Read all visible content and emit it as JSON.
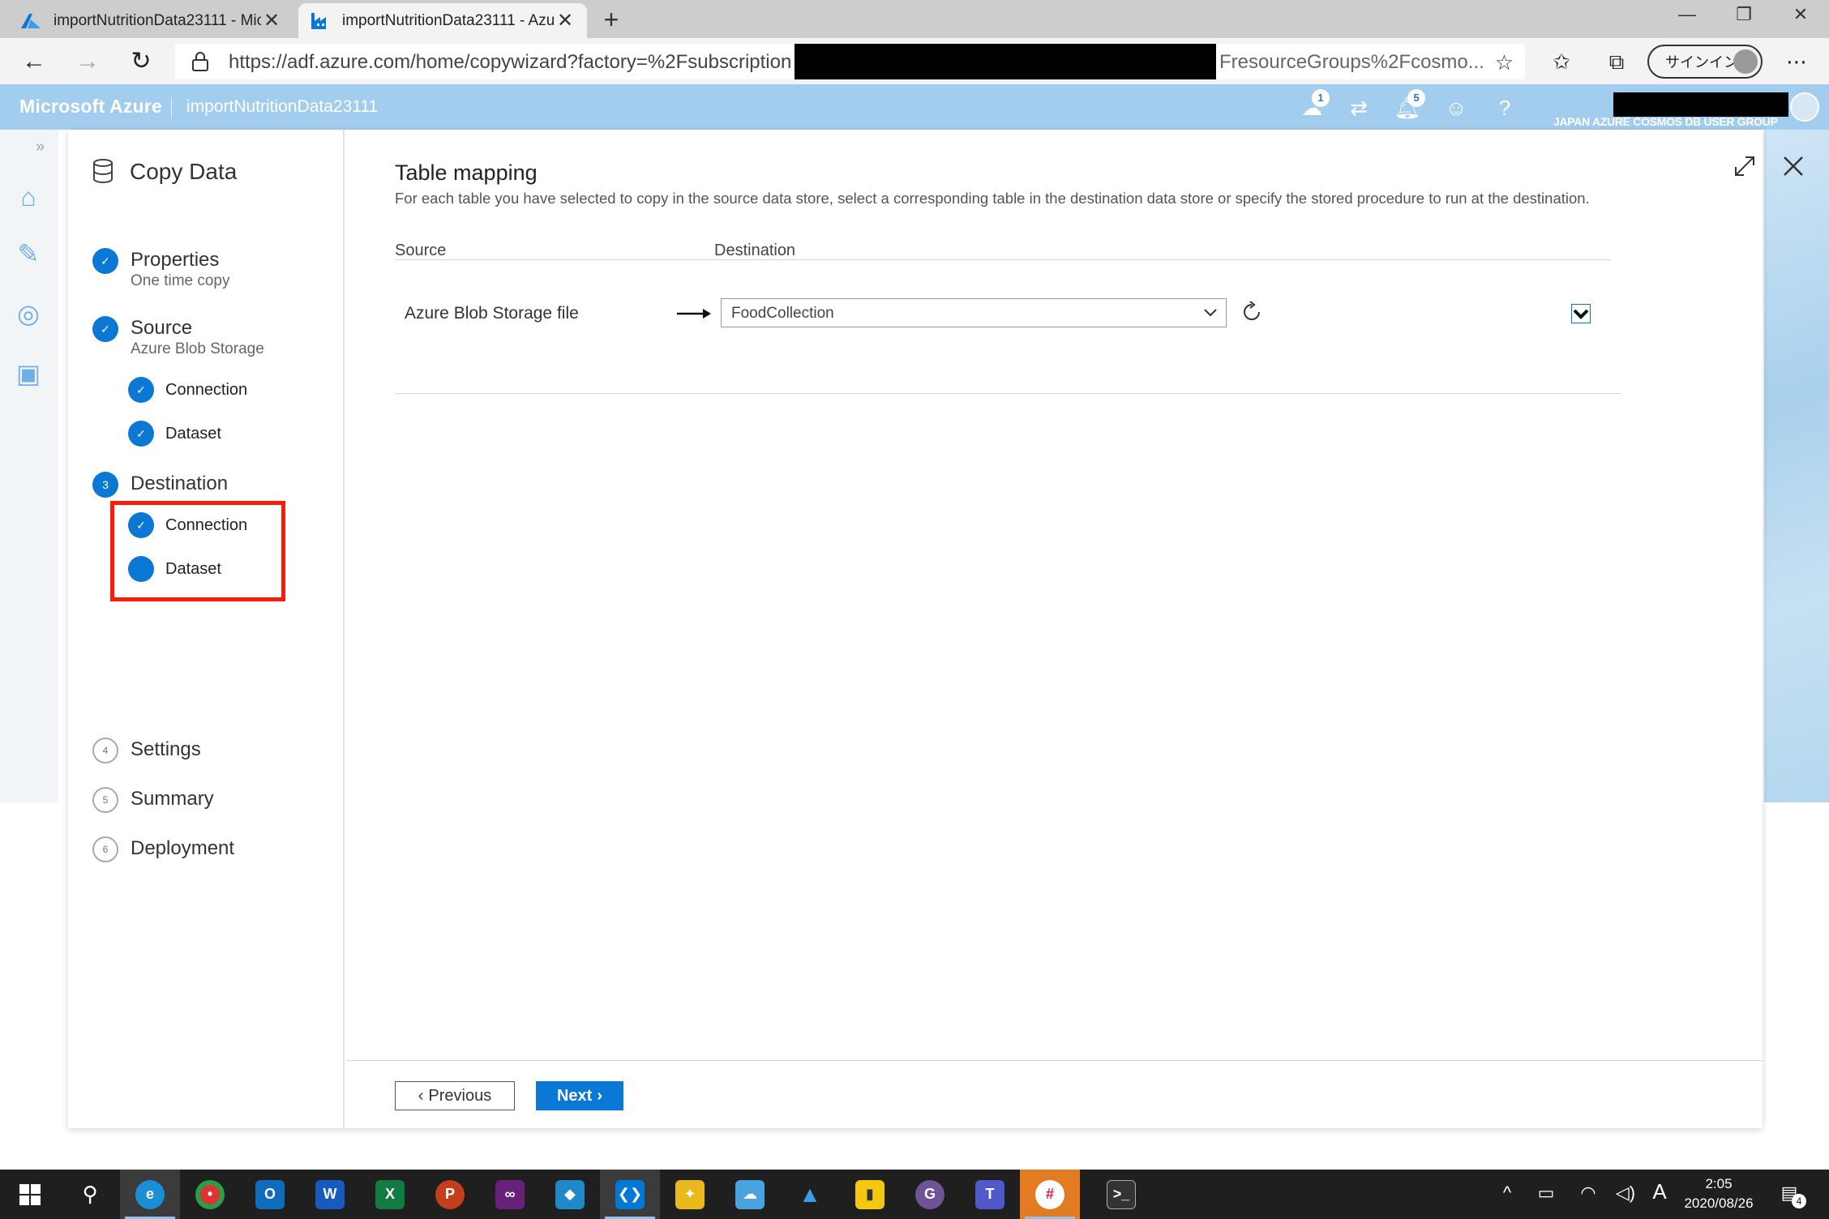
{
  "browser": {
    "tabs": [
      {
        "title": "importNutritionData23111 - Mic",
        "active": false
      },
      {
        "title": "importNutritionData23111 - Azu",
        "active": true
      }
    ],
    "url_prefix": "https://adf.azure.com/home/copywizard?factory=%2Fsubscription",
    "url_suffix": "FresourceGroups%2Fcosmo...",
    "signin_label": "サインイン"
  },
  "azure_header": {
    "brand": "Microsoft Azure",
    "factory_name": "importNutritionData23111",
    "notifications": {
      "feedback_count": "1",
      "bell_count": "5"
    },
    "user_group": "JAPAN AZURE COSMOS DB USER GROUP"
  },
  "wizard": {
    "title": "Copy Data",
    "steps": [
      {
        "number": "✓",
        "label": "Properties",
        "sub": "One time copy",
        "state": "done"
      },
      {
        "number": "✓",
        "label": "Source",
        "sub": "Azure Blob Storage",
        "state": "done",
        "substeps": [
          {
            "label": "Connection",
            "state": "done"
          },
          {
            "label": "Dataset",
            "state": "done"
          }
        ]
      },
      {
        "number": "3",
        "label": "Destination",
        "sub": "",
        "state": "current",
        "substeps": [
          {
            "label": "Connection",
            "state": "done"
          },
          {
            "label": "Dataset",
            "state": "current"
          }
        ]
      },
      {
        "number": "4",
        "label": "Settings",
        "state": "pending"
      },
      {
        "number": "5",
        "label": "Summary",
        "state": "pending"
      },
      {
        "number": "6",
        "label": "Deployment",
        "state": "pending"
      }
    ]
  },
  "content": {
    "title": "Table mapping",
    "description": "For each table you have selected to copy in the source data store, select a corresponding table in the destination data store or specify the stored procedure to run at the destination.",
    "col_source": "Source",
    "col_destination": "Destination",
    "row": {
      "source": "Azure Blob Storage file",
      "destination": "FoodCollection",
      "checked": true
    },
    "buttons": {
      "previous": "Previous",
      "next": "Next"
    }
  },
  "taskbar": {
    "time": "2:05",
    "date": "2020/08/26",
    "ime": "A",
    "notification_count": "4"
  }
}
